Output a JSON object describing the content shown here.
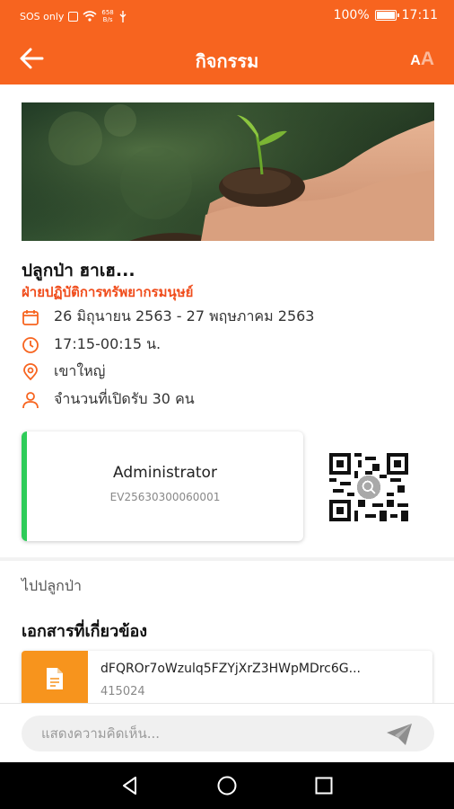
{
  "status_bar": {
    "carrier": "SOS only",
    "speed_value": "658",
    "speed_unit": "B/s",
    "battery": "100%",
    "time": "17:11"
  },
  "app_bar": {
    "title": "กิจกรรม",
    "back_icon": "arrow-left-icon",
    "font_size_small": "A",
    "font_size_large": "A"
  },
  "event": {
    "title": "ปลูกป่า ฮาเฮ...",
    "organizer": "ฝ่ายปฏิบัติการทรัพยากรมนุษย์",
    "date_range": "26 มิถุนายน 2563 - 27 พฤษภาคม 2563",
    "time_range": "17:15-00:15 น.",
    "location": "เขาใหญ่",
    "capacity": "จำนวนที่เปิดรับ 30 คน"
  },
  "ticket": {
    "name": "Administrator",
    "code": "EV25630300060001",
    "accent_color": "#2ecc59"
  },
  "description": "ไปปลูกป่า",
  "documents": {
    "heading": "เอกสารที่เกี่ยวข้อง",
    "items": [
      {
        "name": "dFQROr7oWzulq5FZYjXrZ3HWpMDrc6G...",
        "size": "415024",
        "icon": "document-icon"
      }
    ]
  },
  "comment": {
    "placeholder": "แสดงความคิดเห็น...",
    "send_icon": "send-icon"
  },
  "colors": {
    "primary": "#f7641f",
    "organizer_text": "#f04d1c",
    "document_icon_bg": "#f7941d"
  }
}
